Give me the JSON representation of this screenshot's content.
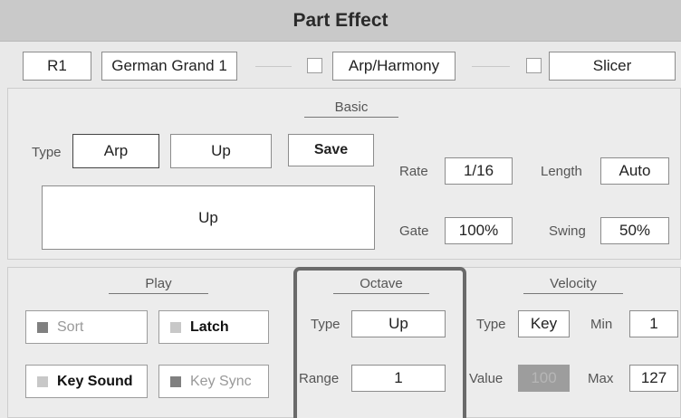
{
  "title": "Part Effect",
  "part_row": {
    "part": "R1",
    "voice": "German Grand 1",
    "arp_harmony_label": "Arp/Harmony",
    "slicer_label": "Slicer"
  },
  "basic": {
    "section_label": "Basic",
    "type_label": "Type",
    "type_value": "Arp",
    "pattern_value": "Up",
    "save_label": "Save",
    "preview_value": "Up",
    "rate_label": "Rate",
    "rate_value": "1/16",
    "length_label": "Length",
    "length_value": "Auto",
    "gate_label": "Gate",
    "gate_value": "100%",
    "swing_label": "Swing",
    "swing_value": "50%"
  },
  "play": {
    "section_label": "Play",
    "sort_label": "Sort",
    "latch_label": "Latch",
    "key_sound_label": "Key Sound",
    "key_sync_label": "Key Sync"
  },
  "octave": {
    "section_label": "Octave",
    "type_label": "Type",
    "type_value": "Up",
    "range_label": "Range",
    "range_value": "1"
  },
  "velocity": {
    "section_label": "Velocity",
    "type_label": "Type",
    "type_value": "Key",
    "min_label": "Min",
    "min_value": "1",
    "value_label": "Value",
    "value_value": "100",
    "max_label": "Max",
    "max_value": "127"
  }
}
